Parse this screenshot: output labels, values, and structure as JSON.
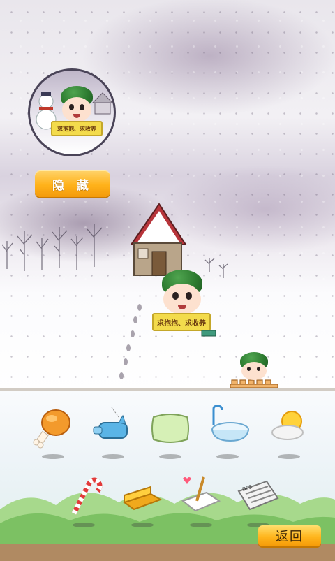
{
  "scene": {
    "avatar_sign_text": "求抱抱、求收养",
    "hide_button_label": "隐 藏",
    "pet_sign_text": "求抱抱、求收养"
  },
  "items": [
    {
      "name": "chicken-leg-icon"
    },
    {
      "name": "toy-pig-icon"
    },
    {
      "name": "pillow-icon"
    },
    {
      "name": "bathtub-icon"
    },
    {
      "name": "sun-cloud-icon"
    },
    {
      "name": "candy-cane-icon"
    },
    {
      "name": "soap-bar-icon"
    },
    {
      "name": "notepad-icon"
    },
    {
      "name": "newspaper-icon"
    }
  ],
  "newspaper_masthead": "DPS",
  "back_button_label": "返回",
  "colors": {
    "button_orange": "#ffb21a",
    "helmet_green": "#2c7a2f",
    "sign_yellow": "#f3db4c"
  }
}
